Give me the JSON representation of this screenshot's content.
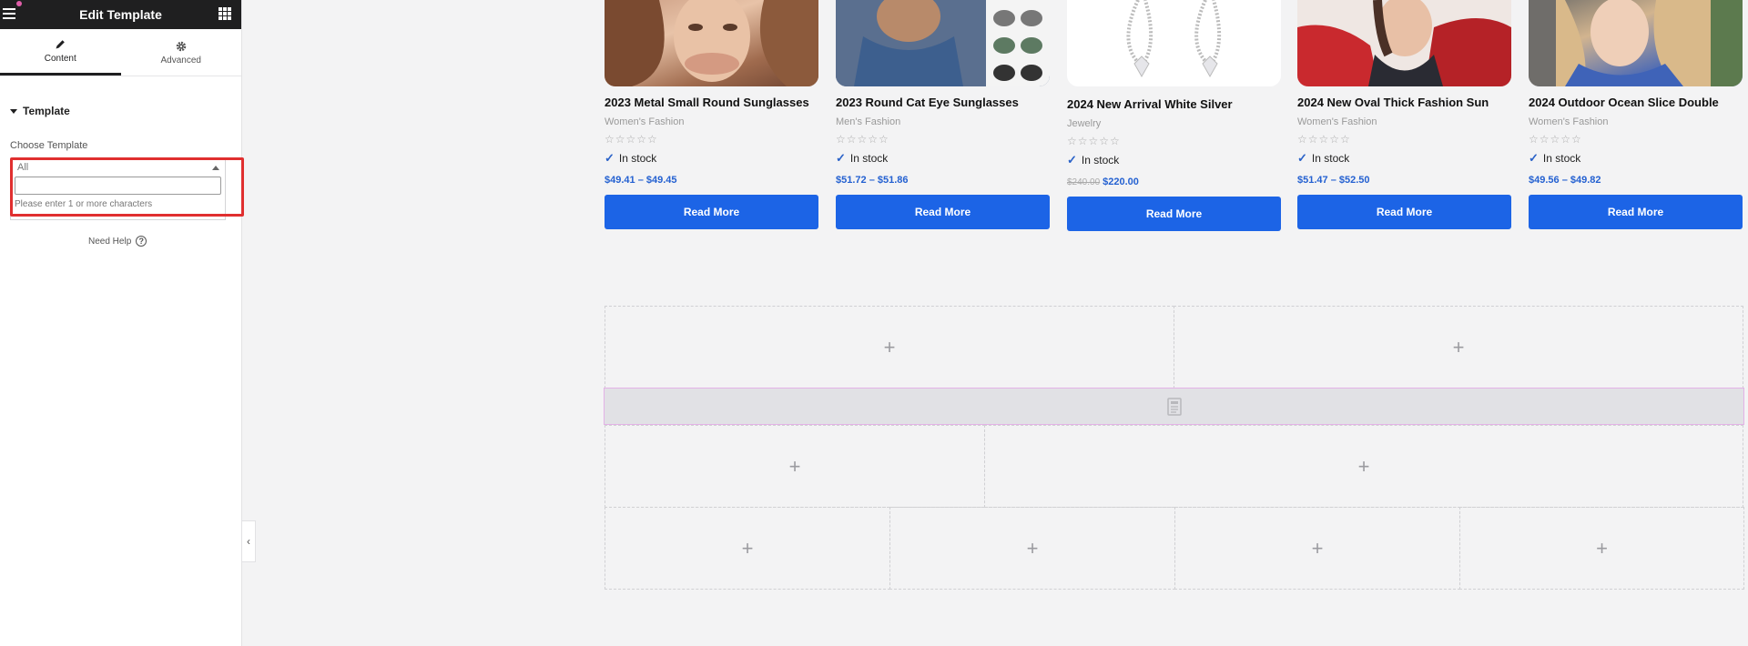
{
  "panel": {
    "title": "Edit Template",
    "tabs": [
      {
        "label": "Content",
        "icon": "pencil-icon",
        "active": true
      },
      {
        "label": "Advanced",
        "icon": "gear-icon",
        "active": false
      }
    ],
    "section_title": "Template",
    "choose_label": "Choose Template",
    "select": {
      "value": "All",
      "search_value": "",
      "message": "Please enter 1 or more characters"
    },
    "need_help": "Need Help"
  },
  "products": [
    {
      "name": "2023 Metal Small Round Sunglasses",
      "category": "Women's Fashion",
      "stock": "In stock",
      "price": "$49.41 – $49.45",
      "old_price": "",
      "button": "Read More"
    },
    {
      "name": "2023 Round Cat Eye Sunglasses",
      "category": "Men's Fashion",
      "stock": "In stock",
      "price": "$51.72 – $51.86",
      "old_price": "",
      "button": "Read More"
    },
    {
      "name": "2024 New Arrival White Silver",
      "category": "Jewelry",
      "stock": "In stock",
      "price": "$220.00",
      "old_price": "$240.00",
      "button": "Read More"
    },
    {
      "name": "2024 New Oval Thick Fashion Sun",
      "category": "Women's Fashion",
      "stock": "In stock",
      "price": "$51.47 – $52.50",
      "old_price": "",
      "button": "Read More"
    },
    {
      "name": "2024 Outdoor Ocean Slice Double",
      "category": "Women's Fashion",
      "stock": "In stock",
      "price": "$49.56 – $49.82",
      "old_price": "",
      "button": "Read More"
    }
  ],
  "stars": "☆☆☆☆☆",
  "add_glyph": "+",
  "colors": {
    "accent": "#1c64e6",
    "price": "#2461d1",
    "highlight": "#e02f2f",
    "header": "#1f1f20"
  }
}
